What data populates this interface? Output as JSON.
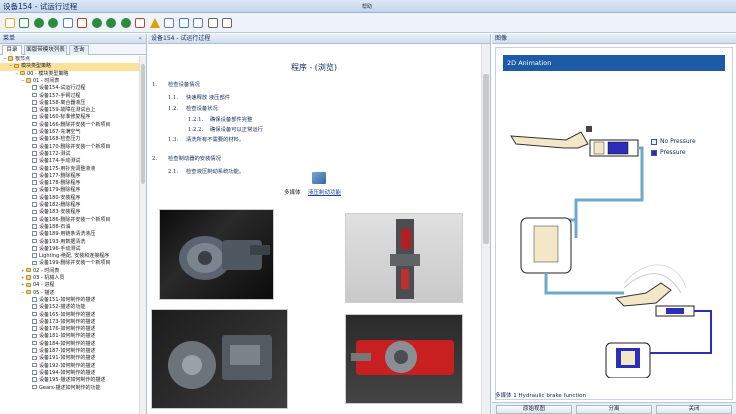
{
  "window": {
    "title": "设备154 - 试运行过程",
    "help": "帮助"
  },
  "toolbar": {
    "icons": [
      "new-icon",
      "open-icon",
      "back-icon",
      "forward-icon",
      "print-icon",
      "notes-icon",
      "prev-icon",
      "next-icon",
      "play-icon",
      "bookmark-icon",
      "warning-icon",
      "settings-icon",
      "globe-icon",
      "stack-icon",
      "zoom-in-icon",
      "zoom-out-icon"
    ]
  },
  "left_pane": {
    "header": "菜单",
    "collapse": "«",
    "tabs": [
      "目录",
      "面版带模块列表",
      "查询"
    ],
    "tree": [
      {
        "label": "根节点",
        "level": 0,
        "type": "folder",
        "toggle": "−"
      },
      {
        "label": "模块类型策略",
        "level": 1,
        "type": "folder",
        "toggle": "−",
        "selected": true
      },
      {
        "label": "00 - 模块类型策略",
        "level": 2,
        "type": "folder",
        "toggle": "−"
      },
      {
        "label": "01 - 时间表",
        "level": 3,
        "type": "folder",
        "toggle": "−"
      },
      {
        "label": "设备154-试运行过程",
        "level": 4,
        "type": "page"
      },
      {
        "label": "设备157-手臂过程",
        "level": 4,
        "type": "page"
      },
      {
        "label": "设备158-离合器液压",
        "level": 4,
        "type": "page"
      },
      {
        "label": "设备159-故障在测试台上",
        "level": 4,
        "type": "page"
      },
      {
        "label": "设备160-标准修复程序",
        "level": 4,
        "type": "page"
      },
      {
        "label": "设备166-删除并安装一个新项目",
        "level": 4,
        "type": "page"
      },
      {
        "label": "设备167-充满空气",
        "level": 4,
        "type": "page"
      },
      {
        "label": "设备168-检查压力",
        "level": 4,
        "type": "page"
      },
      {
        "label": "设备170-删除并安装一个新项目",
        "level": 4,
        "type": "page"
      },
      {
        "label": "设备172-测试",
        "level": 4,
        "type": "page"
      },
      {
        "label": "设备174-手动测试",
        "level": 4,
        "type": "page"
      },
      {
        "label": "设备175-用扑克调整液液",
        "level": 4,
        "type": "page"
      },
      {
        "label": "设备177-删除程序",
        "level": 4,
        "type": "page"
      },
      {
        "label": "设备178-删除程序",
        "level": 4,
        "type": "page"
      },
      {
        "label": "设备179-删除程序",
        "level": 4,
        "type": "page"
      },
      {
        "label": "设备180-安装程序",
        "level": 4,
        "type": "page"
      },
      {
        "label": "设备182-删除程序",
        "level": 4,
        "type": "page"
      },
      {
        "label": "设备183-安装程序",
        "level": 4,
        "type": "page"
      },
      {
        "label": "设备186-删除并安装一个新项目",
        "level": 4,
        "type": "page"
      },
      {
        "label": "设备188-石油",
        "level": 4,
        "type": "page"
      },
      {
        "label": "设备189-用链条清洗液压",
        "level": 4,
        "type": "page"
      },
      {
        "label": "设备193-用数据清洗",
        "level": 4,
        "type": "page"
      },
      {
        "label": "设备196-手动测试",
        "level": 4,
        "type": "page"
      },
      {
        "label": "Lighting-绝配, 安装和连接程序",
        "level": 4,
        "type": "page"
      },
      {
        "label": "设备199-删除并安装一个新项目",
        "level": 4,
        "type": "page"
      },
      {
        "label": "02 - 时间表",
        "level": 3,
        "type": "folder",
        "toggle": "+"
      },
      {
        "label": "03 - 机械人员",
        "level": 3,
        "type": "folder",
        "toggle": "+"
      },
      {
        "label": "04 - 进程",
        "level": 3,
        "type": "folder",
        "toggle": "+"
      },
      {
        "label": "05 - 描述",
        "level": 3,
        "type": "folder",
        "toggle": "−"
      },
      {
        "label": "设备151-如何制作的描述",
        "level": 4,
        "type": "page"
      },
      {
        "label": "设备152-描述的功能",
        "level": 4,
        "type": "page"
      },
      {
        "label": "设备165-如何制作的描述",
        "level": 4,
        "type": "page"
      },
      {
        "label": "设备173-如何制作的描述",
        "level": 4,
        "type": "page"
      },
      {
        "label": "设备176-如何制作的描述",
        "level": 4,
        "type": "page"
      },
      {
        "label": "设备181-如何制作的描述",
        "level": 4,
        "type": "page"
      },
      {
        "label": "设备184-如何制作的描述",
        "level": 4,
        "type": "page"
      },
      {
        "label": "设备187-如何制作的描述",
        "level": 4,
        "type": "page"
      },
      {
        "label": "设备191-如何制作的描述",
        "level": 4,
        "type": "page"
      },
      {
        "label": "设备192-如何制作的描述",
        "level": 4,
        "type": "page"
      },
      {
        "label": "设备194-如何制作的描述",
        "level": 4,
        "type": "page"
      },
      {
        "label": "设备195-描述如何制作的描述",
        "level": 4,
        "type": "page"
      },
      {
        "label": "Gears-描述如何制作的功能",
        "level": 4,
        "type": "page"
      }
    ]
  },
  "middle_pane": {
    "header": "设备154 - 试运行过程",
    "heading": "程序 - (浏览)",
    "outline": [
      {
        "num": "1.",
        "text": "检查设备情况",
        "indent": 0
      },
      {
        "num": "1.1.",
        "text": "快速释放 液压部件",
        "indent": 1
      },
      {
        "num": "1.2.",
        "text": "检查设备状况",
        "indent": 1
      },
      {
        "num": "1.2.1.",
        "text": "确保设备部件完整",
        "indent": 2
      },
      {
        "num": "1.2.2.",
        "text": "确保设备可以正常运行",
        "indent": 2
      },
      {
        "num": "1.3.",
        "text": "清洗所有不需要的材料。",
        "indent": 1
      },
      {
        "num": "2.",
        "text": "检查制动器的安装情况",
        "indent": 0
      },
      {
        "num": "2.1.",
        "text": "检查液压制动系统功能。",
        "indent": 1
      }
    ],
    "multimedia": {
      "label": "多媒体",
      "link": "液压制动功能"
    }
  },
  "right_pane": {
    "header": "图像",
    "viewer_title": "2D Animation",
    "legend": [
      {
        "label": "No Pressure",
        "color": "#e6f6f6"
      },
      {
        "label": "Pressure",
        "color": "#2c2db8"
      }
    ],
    "caption": "多媒体 1 Hydraulic brake function",
    "buttons": [
      "原始视图",
      "分离",
      "关闭"
    ]
  },
  "colors": {
    "accent": "#1d5ba6",
    "selected": "#fbe29a"
  }
}
